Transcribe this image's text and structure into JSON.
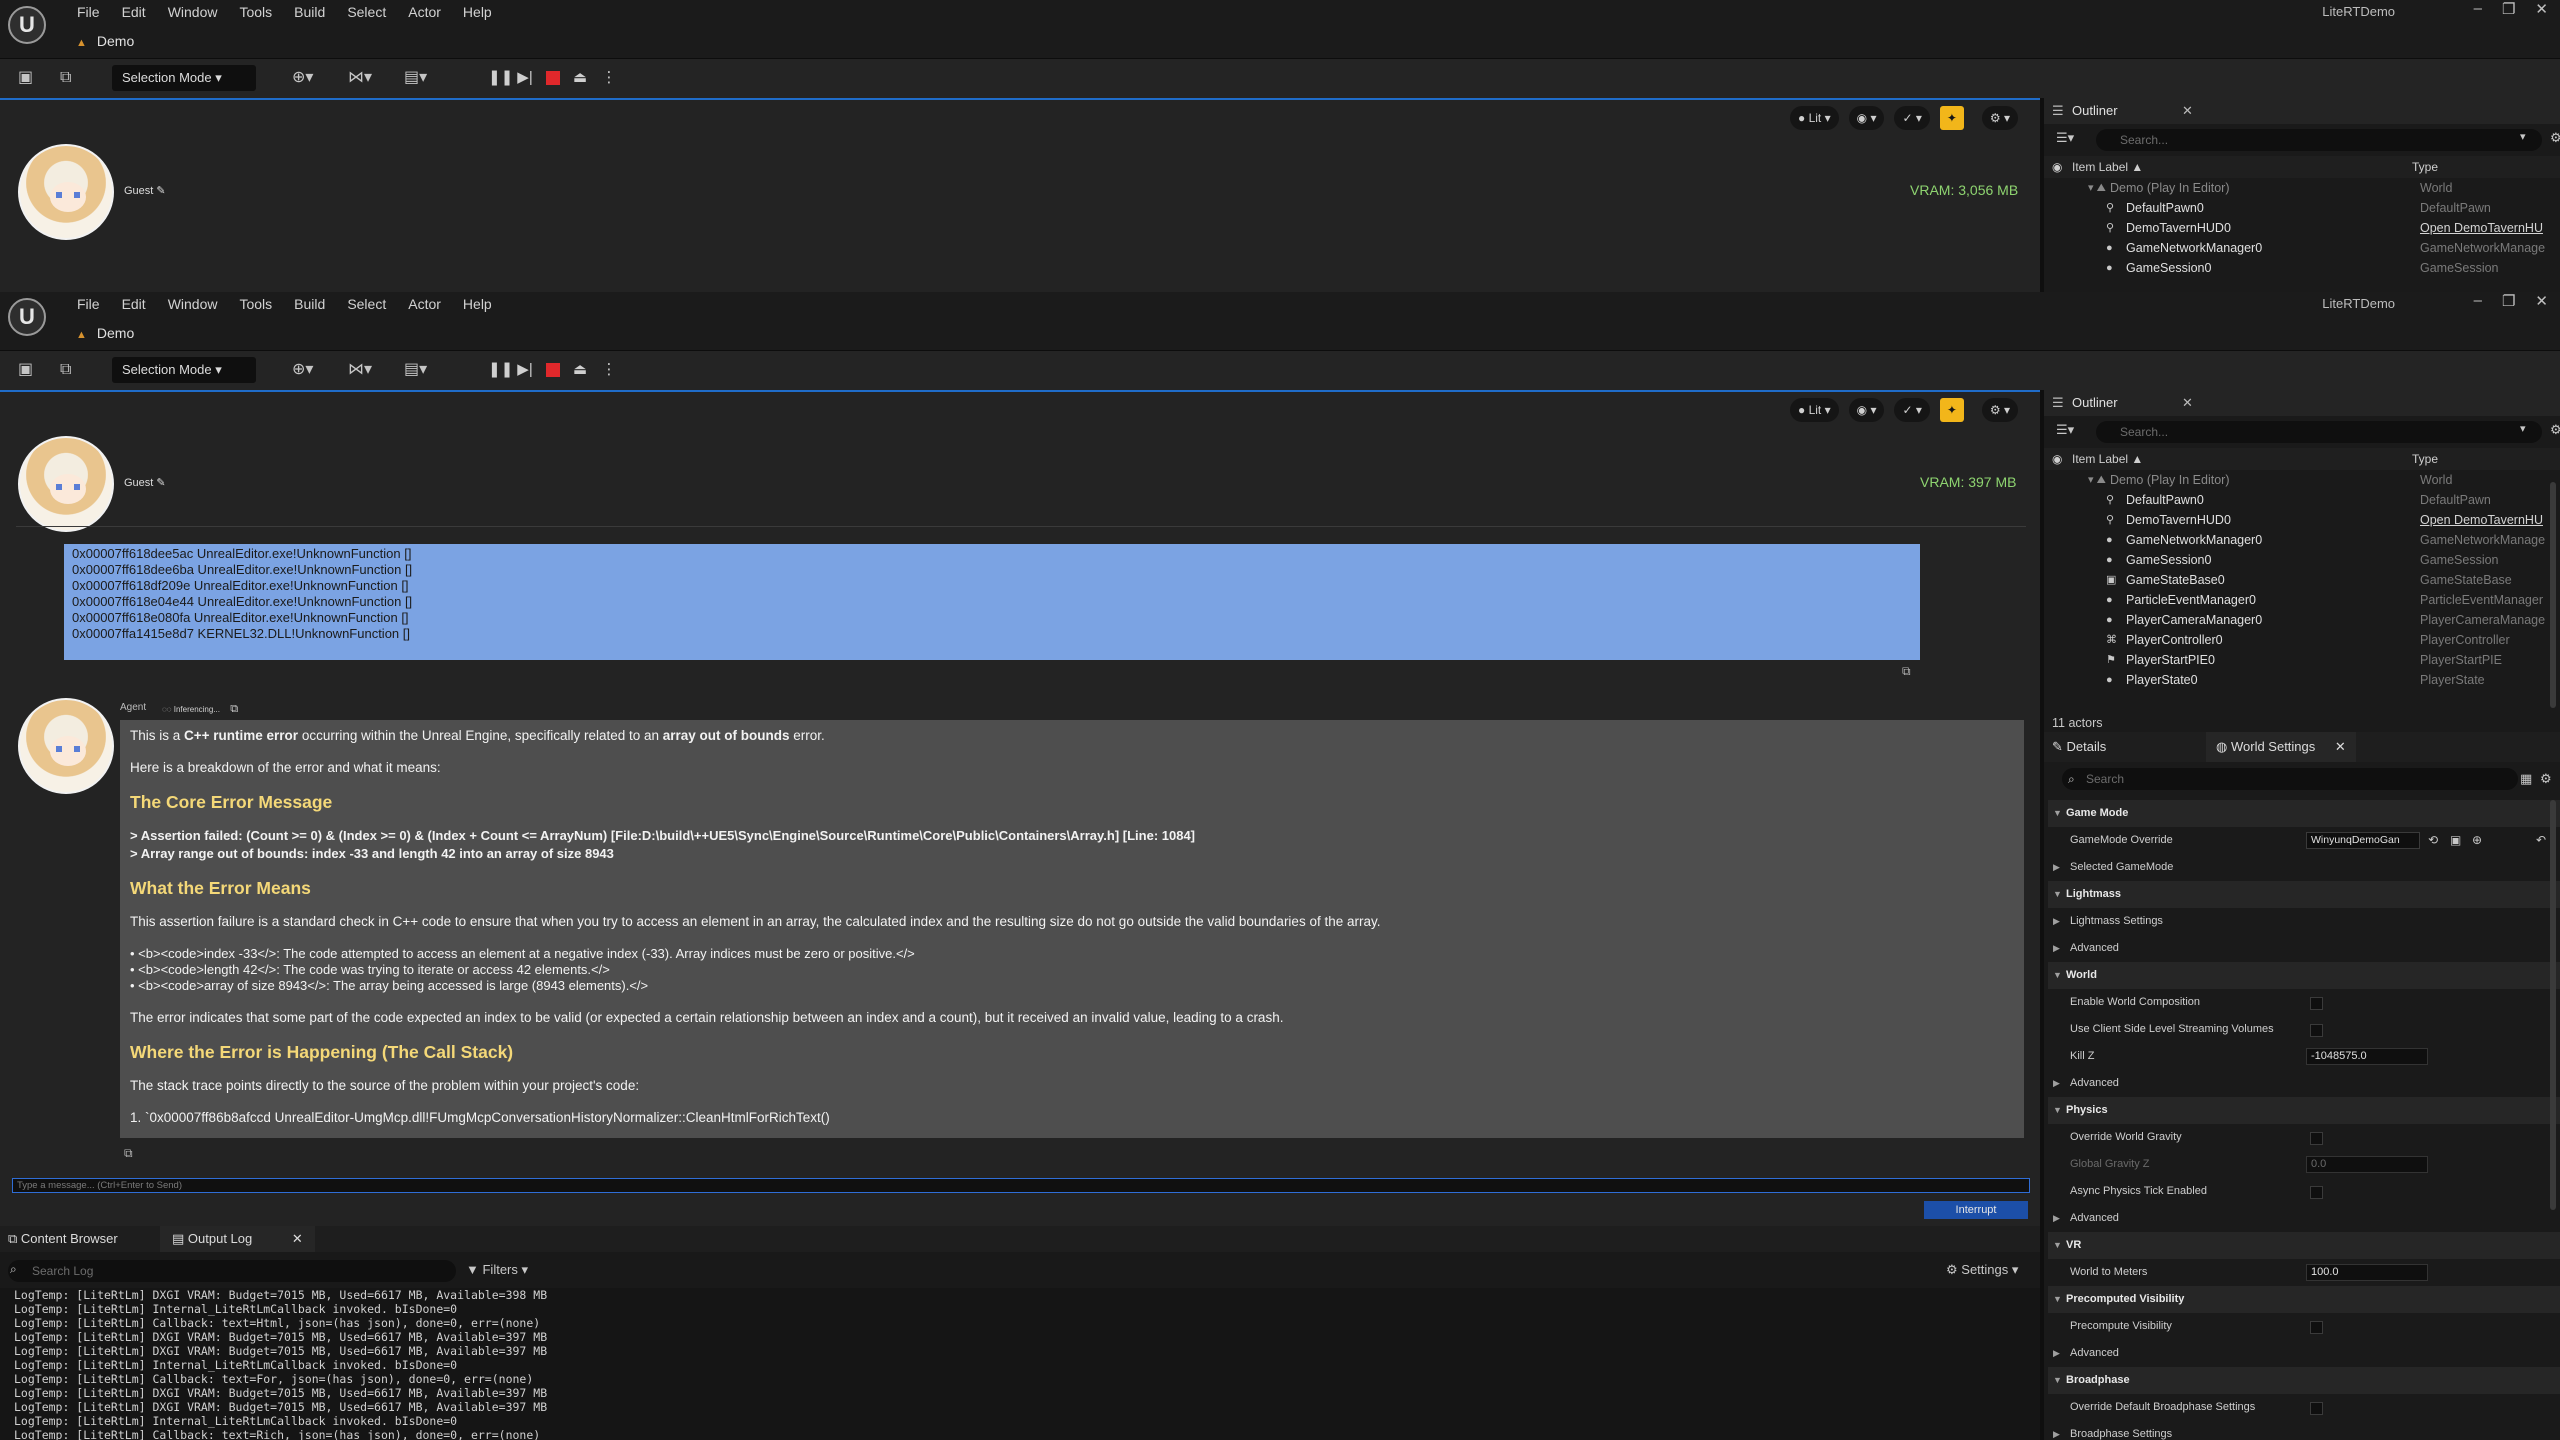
{
  "app": {
    "title": "LiteRTDemo",
    "menu": [
      "File",
      "Edit",
      "Window",
      "Tools",
      "Build",
      "Select",
      "Actor",
      "Help"
    ],
    "level_tab": "Demo",
    "selection_mode": "Selection Mode",
    "window_controls": [
      "–",
      "❐",
      "✕"
    ]
  },
  "viewport": {
    "lit_label": "Lit",
    "guest_label": "Guest",
    "vram_top": "VRAM: 3,056 MB",
    "vram_main": "VRAM: 397 MB"
  },
  "outliner": {
    "title": "Outliner",
    "search_placeholder": "Search...",
    "col_label": "Item Label",
    "col_type": "Type",
    "rows": [
      {
        "label": "Demo (Play In Editor)",
        "type": "World"
      },
      {
        "label": "DefaultPawn0",
        "type": "DefaultPawn"
      },
      {
        "label": "DemoTavernHUD0",
        "type": "Open DemoTavernHU"
      },
      {
        "label": "GameNetworkManager0",
        "type": "GameNetworkManage"
      },
      {
        "label": "GameSession0",
        "type": "GameSession"
      },
      {
        "label": "GameStateBase0",
        "type": "GameStateBase"
      },
      {
        "label": "ParticleEventManager0",
        "type": "ParticleEventManager"
      },
      {
        "label": "PlayerCameraManager0",
        "type": "PlayerCameraManage"
      },
      {
        "label": "PlayerController0",
        "type": "PlayerController"
      },
      {
        "label": "PlayerStartPIE0",
        "type": "PlayerStartPIE"
      },
      {
        "label": "PlayerState0",
        "type": "PlayerState"
      }
    ],
    "actor_count": "11 actors"
  },
  "chat": {
    "trace_lines": [
      "0x00007ff618dee5ac UnrealEditor.exe!UnknownFunction []",
      "0x00007ff618dee6ba UnrealEditor.exe!UnknownFunction []",
      "0x00007ff618df209e UnrealEditor.exe!UnknownFunction []",
      "0x00007ff618e04e44 UnrealEditor.exe!UnknownFunction []",
      "0x00007ff618e080fa UnrealEditor.exe!UnknownFunction []",
      "0x00007ffa1415e8d7 KERNEL32.DLL!UnknownFunction []"
    ],
    "agent_label": "Agent",
    "inferencing": "Inferencing...",
    "intro_pre": "This is a ",
    "intro_b1": "C++ runtime error",
    "intro_mid": " occurring within the Unreal Engine, specifically related to an ",
    "intro_b2": "array out of bounds",
    "intro_post": " error.",
    "breakdown": "Here is a breakdown of the error and what it means:",
    "h_core": "The Core Error Message",
    "assert1": "> Assertion failed: (Count >= 0) & (Index >= 0) & (Index + Count <= ArrayNum) [File:D:\\build\\++UE5\\Sync\\Engine\\Source\\Runtime\\Core\\Public\\Containers\\Array.h] [Line: 1084]",
    "assert2": "> Array range out of bounds: index -33 and length 42 into an array of size 8943",
    "h_means": "What the Error Means",
    "means_text": "This assertion failure is a standard check in C++ code to ensure that when you try to access an element in an array, the calculated index and the resulting size do not go outside the valid boundaries of the array.",
    "bullet1": "• <b><code>index -33</>: The code attempted to access an element at a negative index (-33). Array indices must be zero or positive.</>",
    "bullet2": "• <b><code>length 42</>: The code was trying to iterate or access 42 elements.</>",
    "bullet3": "• <b><code>array of size 8943</>: The array being accessed is large (8943 elements).</>",
    "indicates": "The error indicates that some part of the code expected an index to be valid (or expected a certain relationship between an index and a count), but it received an invalid value, leading to a crash.",
    "h_where": "Where the Error is Happening (The Call Stack)",
    "stack_text": "The stack trace points directly to the source of the problem within your project's code:",
    "stack_item": "1. `0x00007ff86b8afccd UnrealEditor-UmgMcp.dll!FUmgMcpConversationHistoryNormalizer::CleanHtmlForRichText()",
    "input_placeholder": "Type a message... (Ctrl+Enter to Send)",
    "interrupt": "Interrupt"
  },
  "bottom": {
    "tab_content": "Content Browser",
    "tab_log": "Output Log",
    "search_placeholder": "Search Log",
    "filters": "Filters",
    "settings": "Settings",
    "log_lines": [
      "LogTemp: [LiteRtLm] DXGI VRAM: Budget=7015 MB, Used=6617 MB, Available=398 MB",
      "LogTemp: [LiteRtLm] Internal_LiteRtLmCallback invoked. bIsDone=0",
      "LogTemp: [LiteRtLm] Callback: text=Html, json=(has json), done=0, err=(none)",
      "LogTemp: [LiteRtLm] DXGI VRAM: Budget=7015 MB, Used=6617 MB, Available=397 MB",
      "LogTemp: [LiteRtLm] DXGI VRAM: Budget=7015 MB, Used=6617 MB, Available=397 MB",
      "LogTemp: [LiteRtLm] Internal_LiteRtLmCallback invoked. bIsDone=0",
      "LogTemp: [LiteRtLm] Callback: text=For, json=(has json), done=0, err=(none)",
      "LogTemp: [LiteRtLm] DXGI VRAM: Budget=7015 MB, Used=6617 MB, Available=397 MB",
      "LogTemp: [LiteRtLm] DXGI VRAM: Budget=7015 MB, Used=6617 MB, Available=397 MB",
      "LogTemp: [LiteRtLm] Internal_LiteRtLmCallback invoked. bIsDone=0",
      "LogTemp: [LiteRtLm] Callback: text=Rich, json=(has json), done=0, err=(none)"
    ]
  },
  "details": {
    "tab_details": "Details",
    "tab_world": "World Settings",
    "search_placeholder": "Search",
    "rows": [
      {
        "kind": "cat",
        "text": "Game Mode"
      },
      {
        "kind": "prop",
        "text": "GameMode Override",
        "dropdown": "WinyunqDemoGan"
      },
      {
        "kind": "sub",
        "text": "Selected GameMode"
      },
      {
        "kind": "cat",
        "text": "Lightmass"
      },
      {
        "kind": "sub",
        "text": "Lightmass Settings"
      },
      {
        "kind": "sub",
        "text": "Advanced"
      },
      {
        "kind": "cat",
        "text": "World"
      },
      {
        "kind": "prop",
        "text": "Enable World Composition",
        "check": true
      },
      {
        "kind": "prop",
        "text": "Use Client Side Level Streaming Volumes",
        "check": true
      },
      {
        "kind": "prop",
        "text": "Kill Z",
        "num": "-1048575.0"
      },
      {
        "kind": "sub",
        "text": "Advanced"
      },
      {
        "kind": "cat",
        "text": "Physics"
      },
      {
        "kind": "prop",
        "text": "Override World Gravity",
        "check": true
      },
      {
        "kind": "prop",
        "text": "Global Gravity Z",
        "num": "0.0",
        "dim": true
      },
      {
        "kind": "prop",
        "text": "Async Physics Tick Enabled",
        "check": true
      },
      {
        "kind": "sub",
        "text": "Advanced"
      },
      {
        "kind": "cat",
        "text": "VR"
      },
      {
        "kind": "prop",
        "text": "World to Meters",
        "num": "100.0"
      },
      {
        "kind": "cat",
        "text": "Precomputed Visibility"
      },
      {
        "kind": "prop",
        "text": "Precompute Visibility",
        "check": true
      },
      {
        "kind": "sub",
        "text": "Advanced"
      },
      {
        "kind": "cat",
        "text": "Broadphase"
      },
      {
        "kind": "prop",
        "text": "Override Default Broadphase Settings",
        "check": true
      },
      {
        "kind": "sub",
        "text": "Broadphase Settings"
      }
    ]
  }
}
